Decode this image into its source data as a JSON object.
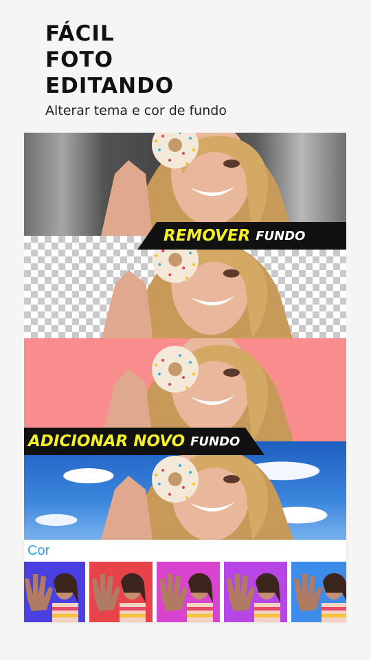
{
  "header": {
    "line1": "FÁCIL",
    "line2": "FOTO",
    "line3": "EDITANDO",
    "subtitle": "Alterar tema e cor de fundo"
  },
  "banner_remove": {
    "big": "REMOVER",
    "small": "FUNDO"
  },
  "banner_add": {
    "big": "ADICIONAR NOVO",
    "small": "FUNDO"
  },
  "color_panel": {
    "label": "Cor",
    "swatches": [
      "#4a3fe0",
      "#e8424a",
      "#d844d0",
      "#b845e6",
      "#3e8cea",
      "#39c7e8"
    ]
  }
}
